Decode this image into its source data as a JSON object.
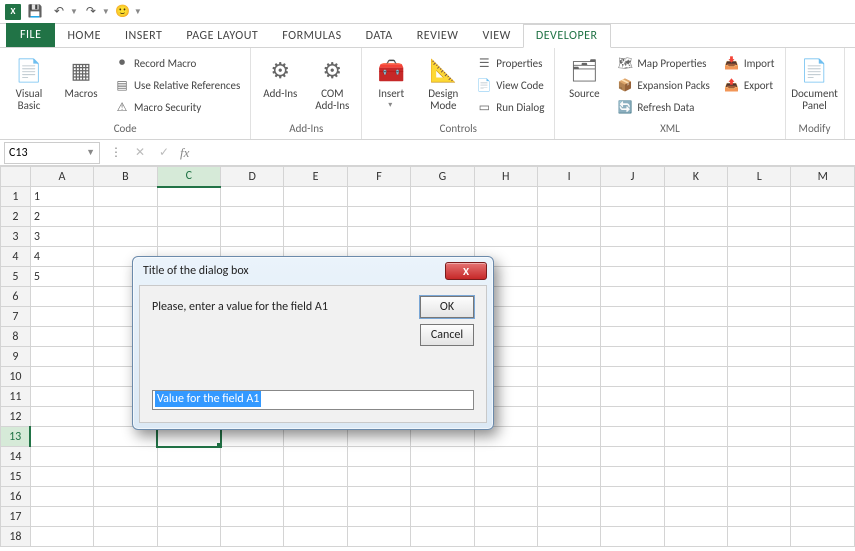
{
  "qat": {
    "save": "💾",
    "undo": "↶",
    "redo": "↷",
    "emoji": "🙂"
  },
  "tabs": {
    "file": "FILE",
    "home": "HOME",
    "insert": "INSERT",
    "pagelayout": "PAGE LAYOUT",
    "formulas": "FORMULAS",
    "data": "DATA",
    "review": "REVIEW",
    "view": "VIEW",
    "developer": "DEVELOPER"
  },
  "ribbon": {
    "code": {
      "label": "Code",
      "visual_basic": "Visual\nBasic",
      "macros": "Macros",
      "record_macro": "Record Macro",
      "use_relative": "Use Relative References",
      "macro_security": "Macro Security"
    },
    "addins": {
      "label": "Add-Ins",
      "addins": "Add-Ins",
      "com": "COM\nAdd-Ins"
    },
    "controls": {
      "label": "Controls",
      "insert": "Insert",
      "design": "Design\nMode",
      "properties": "Properties",
      "view_code": "View Code",
      "run_dialog": "Run Dialog"
    },
    "xml": {
      "label": "XML",
      "source": "Source",
      "map_props": "Map Properties",
      "expansion": "Expansion Packs",
      "refresh": "Refresh Data",
      "import": "Import",
      "export": "Export"
    },
    "modify": {
      "label": "Modify",
      "doc_panel": "Document\nPanel"
    }
  },
  "formula_bar": {
    "cell_ref": "C13",
    "fx": "fx"
  },
  "columns": [
    "A",
    "B",
    "C",
    "D",
    "E",
    "F",
    "G",
    "H",
    "I",
    "J",
    "K",
    "L",
    "M"
  ],
  "rows": [
    "1",
    "2",
    "3",
    "4",
    "5",
    "6",
    "7",
    "8",
    "9",
    "10",
    "11",
    "12",
    "13",
    "14",
    "15",
    "16",
    "17",
    "18"
  ],
  "cells": {
    "A1": "1",
    "A2": "2",
    "A3": "3",
    "A4": "4",
    "A5": "5"
  },
  "selected": {
    "row": 13,
    "col": "C"
  },
  "dialog": {
    "title": "Title of the dialog box",
    "message": "Please, enter a value for the field A1",
    "ok": "OK",
    "cancel": "Cancel",
    "input_value": "Value for the field A1",
    "close": "X"
  }
}
